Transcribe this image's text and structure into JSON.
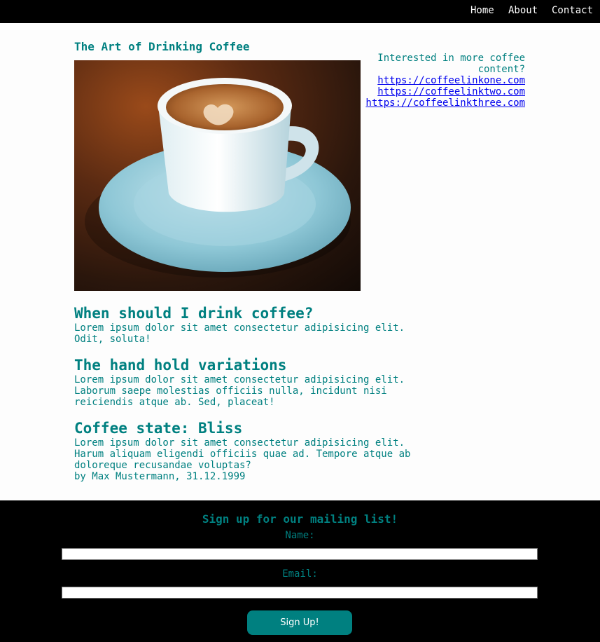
{
  "nav": {
    "home": "Home",
    "about": "About",
    "contact": "Contact"
  },
  "article": {
    "title": "The Art of Drinking Coffee",
    "image_alt": "Cup of coffee on a saucer",
    "sections": [
      {
        "heading": "When should I drink coffee?",
        "text": "Lorem ipsum dolor sit amet consectetur adipisicing elit. Odit, soluta!"
      },
      {
        "heading": "The hand hold variations",
        "text": "Lorem ipsum dolor sit amet consectetur adipisicing elit. Laborum saepe molestias officiis nulla, incidunt nisi reiciendis atque ab. Sed, placeat!"
      },
      {
        "heading": "Coffee state: Bliss",
        "text": "Lorem ipsum dolor sit amet consectetur adipisicing elit. Harum aliquam eligendi officiis quae ad. Tempore atque ab doloreque recusandae voluptas?"
      }
    ],
    "byline": "by Max Mustermann, 31.12.1999"
  },
  "aside": {
    "intro": "Interested in more coffee content?",
    "links": [
      "https://coffeelinkone.com",
      "https://coffeelinktwo.com",
      "https://coffeelinkthree.com"
    ]
  },
  "footer": {
    "title": "Sign up for our mailing list!",
    "name_label": "Name:",
    "name_value": "",
    "email_label": "Email:",
    "email_value": "",
    "button_label": "Sign Up!"
  },
  "colors": {
    "accent": "#008080",
    "nav_bg": "#000000",
    "link": "#0000ee"
  }
}
